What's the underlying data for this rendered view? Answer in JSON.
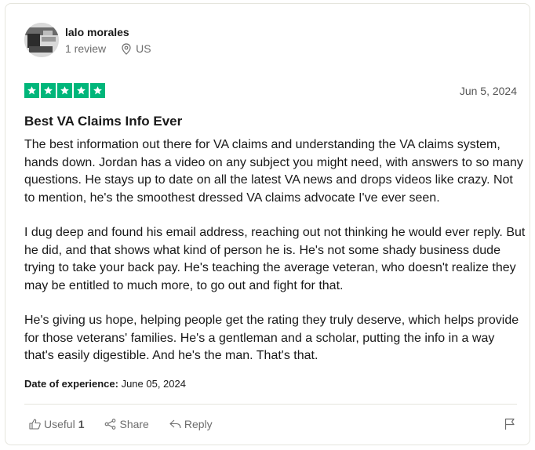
{
  "reviewer": {
    "name": "lalo morales",
    "review_count": "1 review",
    "location": "US"
  },
  "rating": {
    "stars": 5,
    "max": 5,
    "color": "#00b67a"
  },
  "review": {
    "date": "Jun 5, 2024",
    "title": "Best VA Claims Info Ever",
    "paragraphs": [
      "The best information out there for VA claims and understanding the VA claims system, hands down. Jordan has a video on any subject you might need, with answers to so many questions. He stays up to date on all the latest VA news and drops videos like crazy. Not to mention, he's the smoothest dressed VA claims advocate I've ever seen.",
      "I dug deep and found his email address, reaching out not thinking he would ever reply. But he did, and that shows what kind of person he is. He's not some shady business dude trying to take your back pay. He's teaching the average veteran, who doesn't realize they may be entitled to much more, to go out and fight for that.",
      "He's giving us hope, helping people get the rating they truly deserve, which helps provide for those veterans' families. He's a gentleman and a scholar, putting the info in a way that's easily digestible. And he's the man. That's that."
    ],
    "experience_label": "Date of experience:",
    "experience_date": "June 05, 2024"
  },
  "actions": {
    "useful_label": "Useful",
    "useful_count": "1",
    "share_label": "Share",
    "reply_label": "Reply"
  }
}
